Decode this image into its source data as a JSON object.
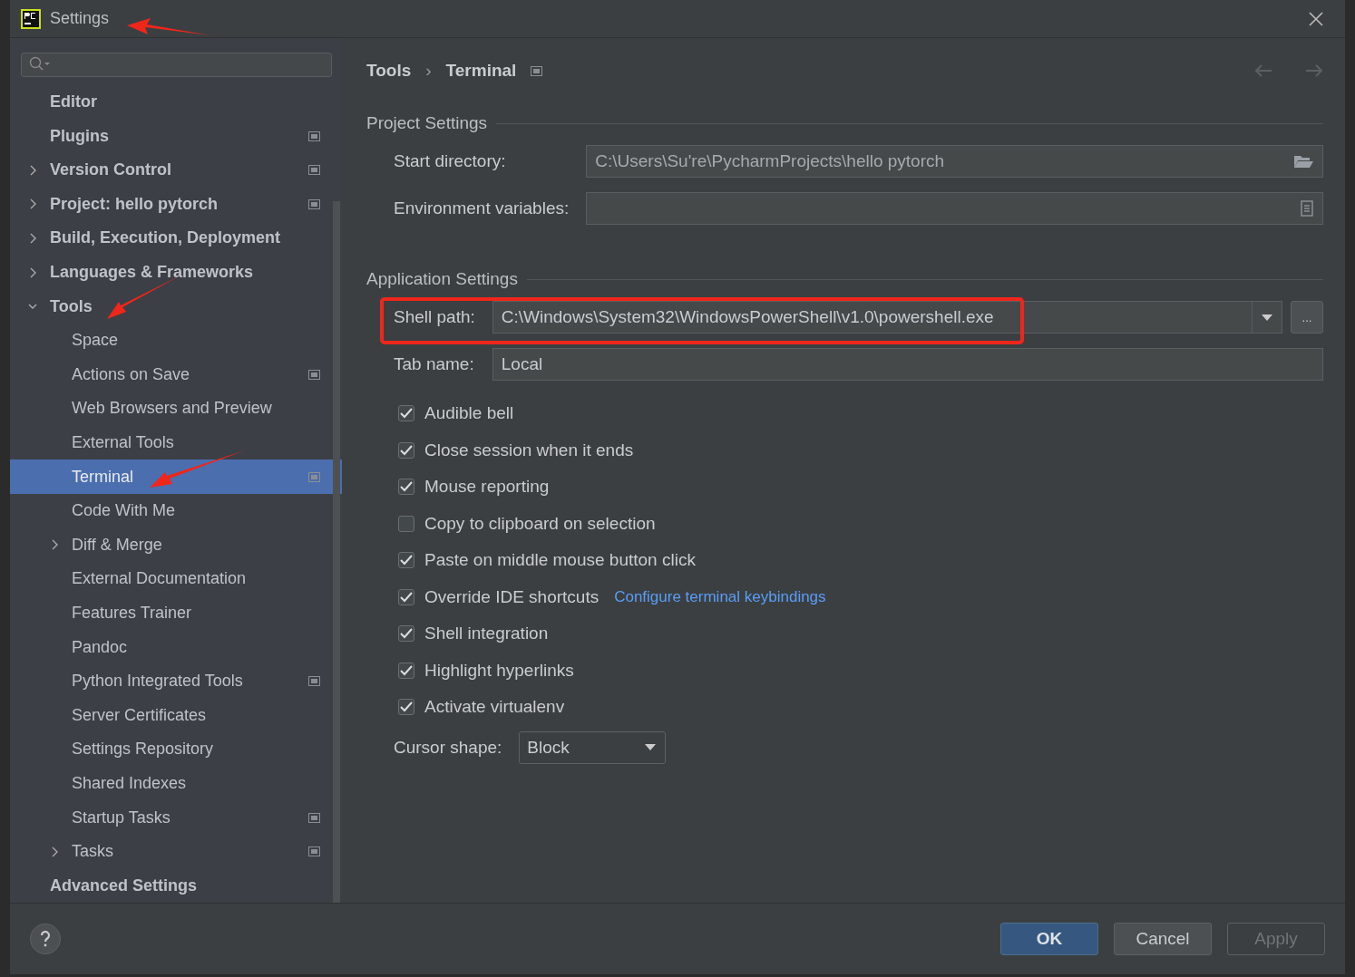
{
  "window": {
    "title": "Settings"
  },
  "sidebar": {
    "items": [
      {
        "label": "Editor",
        "expandable": false,
        "selected": false,
        "scoped": false
      },
      {
        "label": "Plugins",
        "expandable": false,
        "selected": false,
        "scoped": true
      },
      {
        "label": "Version Control",
        "expandable": true,
        "expanded": false,
        "selected": false,
        "scoped": true
      },
      {
        "label": "Project: hello pytorch",
        "expandable": true,
        "expanded": false,
        "selected": false,
        "scoped": true
      },
      {
        "label": "Build, Execution, Deployment",
        "expandable": true,
        "expanded": false,
        "selected": false,
        "scoped": false
      },
      {
        "label": "Languages & Frameworks",
        "expandable": true,
        "expanded": false,
        "selected": false,
        "scoped": false
      },
      {
        "label": "Tools",
        "expandable": true,
        "expanded": true,
        "selected": false,
        "scoped": false,
        "children": [
          {
            "label": "Space",
            "expandable": false,
            "selected": false,
            "scoped": false
          },
          {
            "label": "Actions on Save",
            "expandable": false,
            "selected": false,
            "scoped": true
          },
          {
            "label": "Web Browsers and Preview",
            "expandable": false,
            "selected": false,
            "scoped": false
          },
          {
            "label": "External Tools",
            "expandable": false,
            "selected": false,
            "scoped": false
          },
          {
            "label": "Terminal",
            "expandable": false,
            "selected": true,
            "scoped": true
          },
          {
            "label": "Code With Me",
            "expandable": false,
            "selected": false,
            "scoped": false
          },
          {
            "label": "Diff & Merge",
            "expandable": true,
            "expanded": false,
            "selected": false,
            "scoped": false
          },
          {
            "label": "External Documentation",
            "expandable": false,
            "selected": false,
            "scoped": false
          },
          {
            "label": "Features Trainer",
            "expandable": false,
            "selected": false,
            "scoped": false
          },
          {
            "label": "Pandoc",
            "expandable": false,
            "selected": false,
            "scoped": false
          },
          {
            "label": "Python Integrated Tools",
            "expandable": false,
            "selected": false,
            "scoped": true
          },
          {
            "label": "Server Certificates",
            "expandable": false,
            "selected": false,
            "scoped": false
          },
          {
            "label": "Settings Repository",
            "expandable": false,
            "selected": false,
            "scoped": false
          },
          {
            "label": "Shared Indexes",
            "expandable": false,
            "selected": false,
            "scoped": false
          },
          {
            "label": "Startup Tasks",
            "expandable": false,
            "selected": false,
            "scoped": true
          },
          {
            "label": "Tasks",
            "expandable": true,
            "expanded": false,
            "selected": false,
            "scoped": true
          }
        ]
      },
      {
        "label": "Advanced Settings",
        "expandable": false,
        "selected": false,
        "scoped": false
      }
    ]
  },
  "breadcrumb": [
    "Tools",
    "›",
    "Terminal"
  ],
  "sections": [
    {
      "title": "Project Settings",
      "fields": [
        {
          "kind": "path",
          "label": "Start directory:",
          "value": "C:\\Users\\Su're\\PycharmProjects\\hello pytorch"
        },
        {
          "kind": "env",
          "label": "Environment variables:"
        }
      ]
    },
    {
      "title": "Application Settings",
      "fields": [
        {
          "kind": "combo",
          "label": "Shell path:",
          "value": "C:\\Windows\\System32\\WindowsPowerShell\\v1.0\\powershell.exe",
          "button": "..."
        },
        {
          "kind": "text",
          "label": "Tab name:",
          "value": "Local"
        }
      ]
    }
  ],
  "options": [
    {
      "label": "Audible bell",
      "checked": true
    },
    {
      "label": "Close session when it ends",
      "checked": true
    },
    {
      "label": "Mouse reporting",
      "checked": true
    },
    {
      "label": "Copy to clipboard on selection",
      "checked": false
    },
    {
      "label": "Paste on middle mouse button click",
      "checked": true
    },
    {
      "label": "Override IDE shortcuts",
      "checked": true,
      "link": "Configure terminal keybindings"
    },
    {
      "label": "Shell integration",
      "checked": true
    },
    {
      "label": "Highlight hyperlinks",
      "checked": true
    },
    {
      "label": "Activate virtualenv",
      "checked": true
    }
  ],
  "cursor_shape": {
    "label": "Cursor shape:",
    "value": "Block"
  },
  "buttons": [
    {
      "label": "OK",
      "kind": "primary",
      "disabled": false
    },
    {
      "label": "Cancel",
      "kind": "normal",
      "disabled": false
    },
    {
      "label": "Apply",
      "kind": "normal",
      "disabled": true
    }
  ]
}
